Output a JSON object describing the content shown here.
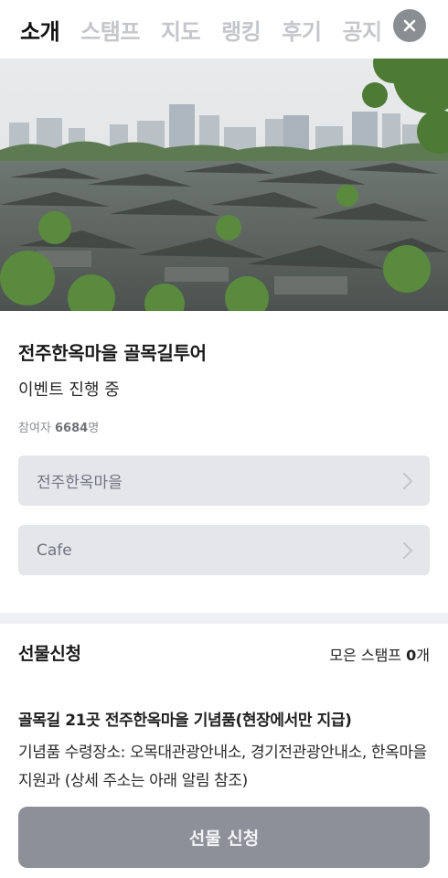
{
  "tabs": [
    {
      "label": "소개",
      "active": true
    },
    {
      "label": "스탬프",
      "active": false
    },
    {
      "label": "지도",
      "active": false
    },
    {
      "label": "랭킹",
      "active": false
    },
    {
      "label": "후기",
      "active": false
    },
    {
      "label": "공지",
      "active": false
    }
  ],
  "close_icon": "close-icon",
  "hero": {
    "icon": "village-photo"
  },
  "tour": {
    "title": "전주한옥마을 골목길투어",
    "status": "이벤트 진행 중",
    "participants_prefix": "참여자 ",
    "participants_count": "6684",
    "participants_suffix": "명"
  },
  "links": [
    {
      "label": "전주한옥마을"
    },
    {
      "label": "Cafe"
    }
  ],
  "gift": {
    "title": "선물신청",
    "stamp_prefix": "모은 스탬프 ",
    "stamp_count": "0",
    "stamp_suffix": "개",
    "reward_title": "골목길 21곳 전주한옥마을 기념품(현장에서만 지급)",
    "reward_desc": "기념품 수령장소: 오목대관광안내소, 경기전관광안내소, 한옥마을지원과 (상세 주소는 아래 알림 참조)",
    "button_label": "선물 신청"
  },
  "colors": {
    "cta_disabled": "#8e9099",
    "row_bg": "#e5e6ea"
  }
}
